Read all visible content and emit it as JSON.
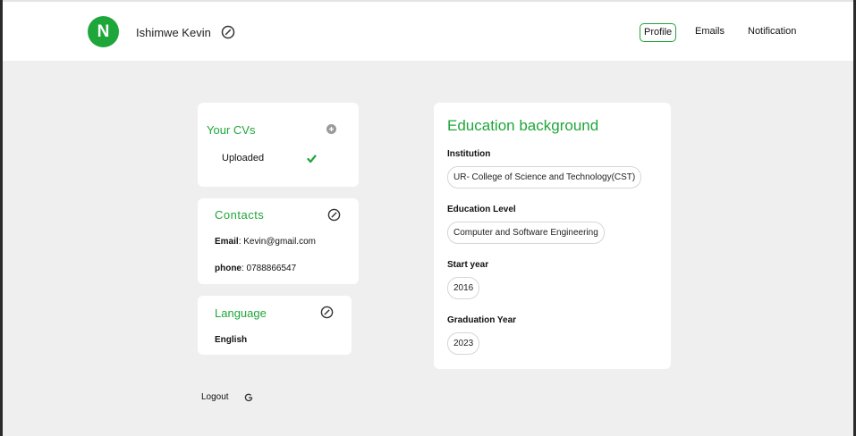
{
  "header": {
    "avatar_letter": "N",
    "username": "Ishimwe Kevin",
    "nav": {
      "profile": "Profile",
      "emails": "Emails",
      "notification": "Notification"
    }
  },
  "cvs": {
    "title": "Your CVs",
    "status": "Uploaded"
  },
  "contacts": {
    "title": "Contacts",
    "email_label": "Email",
    "email_value": ": Kevin@gmail.com",
    "phone_label": "phone",
    "phone_value": ": 0788866547"
  },
  "language": {
    "title": "Language",
    "value": "English"
  },
  "logout": {
    "label": "Logout"
  },
  "education": {
    "title": "Education background",
    "institution_label": "Institution",
    "institution_value": "UR- College of Science and Technology(CST)",
    "level_label": "Education Level",
    "level_value": "Computer and Software Engineering",
    "start_label": "Start year",
    "start_value": "2016",
    "grad_label": "Graduation Year",
    "grad_value": "2023"
  },
  "colors": {
    "accent": "#1fa63a",
    "background": "#efefef",
    "card": "#ffffff"
  },
  "icons": [
    "edit-icon",
    "add-icon",
    "check-icon",
    "logout-icon"
  ]
}
